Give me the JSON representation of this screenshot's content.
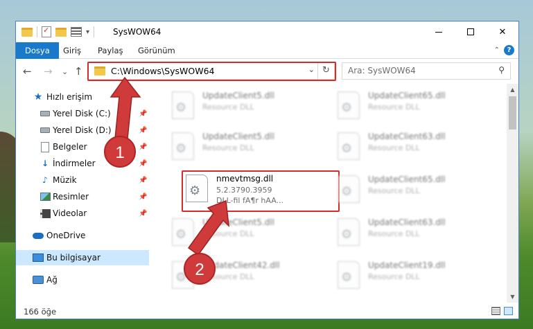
{
  "window": {
    "title": "SysWOW64",
    "buttons": {
      "minimize": "minimize",
      "maximize": "maximize",
      "close": "✕"
    }
  },
  "ribbon": {
    "tabs": [
      "Dosya",
      "Giriş",
      "Paylaş",
      "Görünüm"
    ],
    "help": "?"
  },
  "address_bar": {
    "path": "C:\\Windows\\SysWOW64",
    "search_placeholder": "Ara: SysWOW64"
  },
  "nav": {
    "back": "←",
    "forward": "→",
    "recent": "⌄",
    "up": "↑"
  },
  "nav_pane": {
    "items": [
      {
        "label": "Hızlı erişim",
        "icon": "star-icon",
        "pinned": false
      },
      {
        "label": "Yerel Disk (C:)",
        "icon": "drive-icon",
        "pinned": true
      },
      {
        "label": "Yerel Disk (D:)",
        "icon": "drive-icon",
        "pinned": true
      },
      {
        "label": "Belgeler",
        "icon": "documents-icon",
        "pinned": true
      },
      {
        "label": "İndirmeler",
        "icon": "downloads-icon",
        "pinned": true
      },
      {
        "label": "Müzik",
        "icon": "music-icon",
        "pinned": true
      },
      {
        "label": "Resimler",
        "icon": "pictures-icon",
        "pinned": true
      },
      {
        "label": "Videolar",
        "icon": "videos-icon",
        "pinned": true
      },
      {
        "label": "OneDrive",
        "icon": "cloud-icon",
        "pinned": false
      },
      {
        "label": "Bu bilgisayar",
        "icon": "computer-icon",
        "pinned": false,
        "selected": true
      },
      {
        "label": "Ağ",
        "icon": "network-icon",
        "pinned": false
      }
    ]
  },
  "files": [
    {
      "name": "UpdateClient5.dll",
      "line2": "Resource DLL",
      "blurred": true
    },
    {
      "name": "UpdateClient65.dll",
      "line2": "Resource DLL",
      "blurred": true
    },
    {
      "name": "UpdateClient5.dll",
      "line2": "Resource DLL",
      "blurred": true
    },
    {
      "name": "UpdateClient63.dll",
      "line2": "Resource DLL",
      "blurred": true
    },
    {
      "name": "nmevtmsg.dll",
      "line2": "5.2.3790.3959",
      "line3": "DLL-fil fA¶r hAA...",
      "blurred": false
    },
    {
      "name": "UpdateClient65.dll",
      "line2": "Resource DLL",
      "blurred": true
    },
    {
      "name": "UpdateClient5.dll",
      "line2": "Resource DLL",
      "blurred": true
    },
    {
      "name": "UpdateClient63.dll",
      "line2": "Resource DLL",
      "blurred": true
    },
    {
      "name": "UpdateClient42.dll",
      "line2": "Resource DLL",
      "blurred": true
    },
    {
      "name": "UpdateClient19.dll",
      "line2": "Resource DLL",
      "blurred": true
    }
  ],
  "status": {
    "count": "166 öğe"
  },
  "annotations": {
    "step1": "1",
    "step2": "2",
    "color": "#d62b2b"
  }
}
